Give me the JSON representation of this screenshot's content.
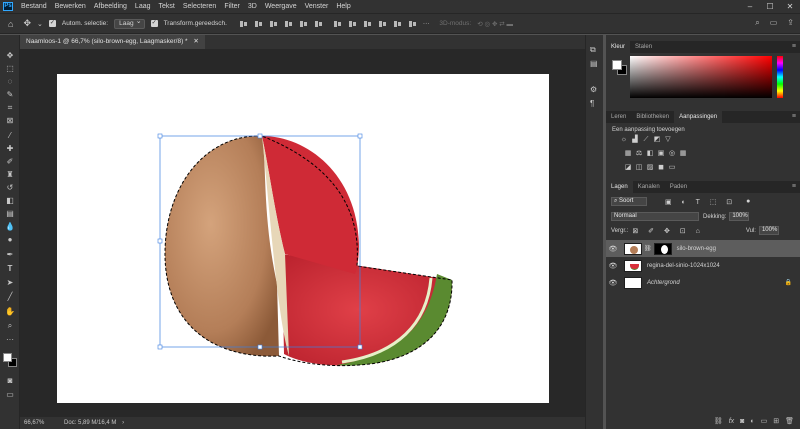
{
  "menubar": {
    "logo": "Ps",
    "items": [
      "Bestand",
      "Bewerken",
      "Afbeelding",
      "Laag",
      "Tekst",
      "Selecteren",
      "Filter",
      "3D",
      "Weergave",
      "Venster",
      "Help"
    ]
  },
  "options": {
    "auto_select_label": "Autom. selectie:",
    "auto_select_value": "Laag",
    "transform_label": "Transform.gereedsch.",
    "mode_3d": "3D-modus:"
  },
  "document_tab": {
    "title": "Naamloos-1 @ 66,7% (silo-brown-egg, Laagmasker/8) *"
  },
  "status": {
    "zoom": "66,67%",
    "doc_info": "Doc: 5,89 M/16,4 M"
  },
  "color_panel": {
    "tabs": [
      "Kleur",
      "Stalen"
    ]
  },
  "adjust_panel": {
    "tabs": [
      "Leren",
      "Bibliotheken",
      "Aanpassingen"
    ],
    "add_label": "Een aanpassing toevoegen"
  },
  "layers_panel": {
    "tabs": [
      "Lagen",
      "Kanalen",
      "Paden"
    ],
    "filter_kind": "Soort",
    "blend_mode": "Normaal",
    "opacity_label": "Dekking:",
    "opacity_value": "100%",
    "lock_label": "Vergr.:",
    "fill_label": "Vul:",
    "fill_value": "100%",
    "layers": [
      {
        "name": "silo-brown-egg",
        "selected": true
      },
      {
        "name": "regina-del-sinio-1024x1024",
        "selected": false
      },
      {
        "name": "Achtergrond",
        "selected": false
      }
    ]
  },
  "colors": {
    "accent": "#31a8ff",
    "selection": "#5d5d5d",
    "egg": "#c0906a",
    "melon": "#d9303a",
    "rind": "#5a8a30"
  }
}
